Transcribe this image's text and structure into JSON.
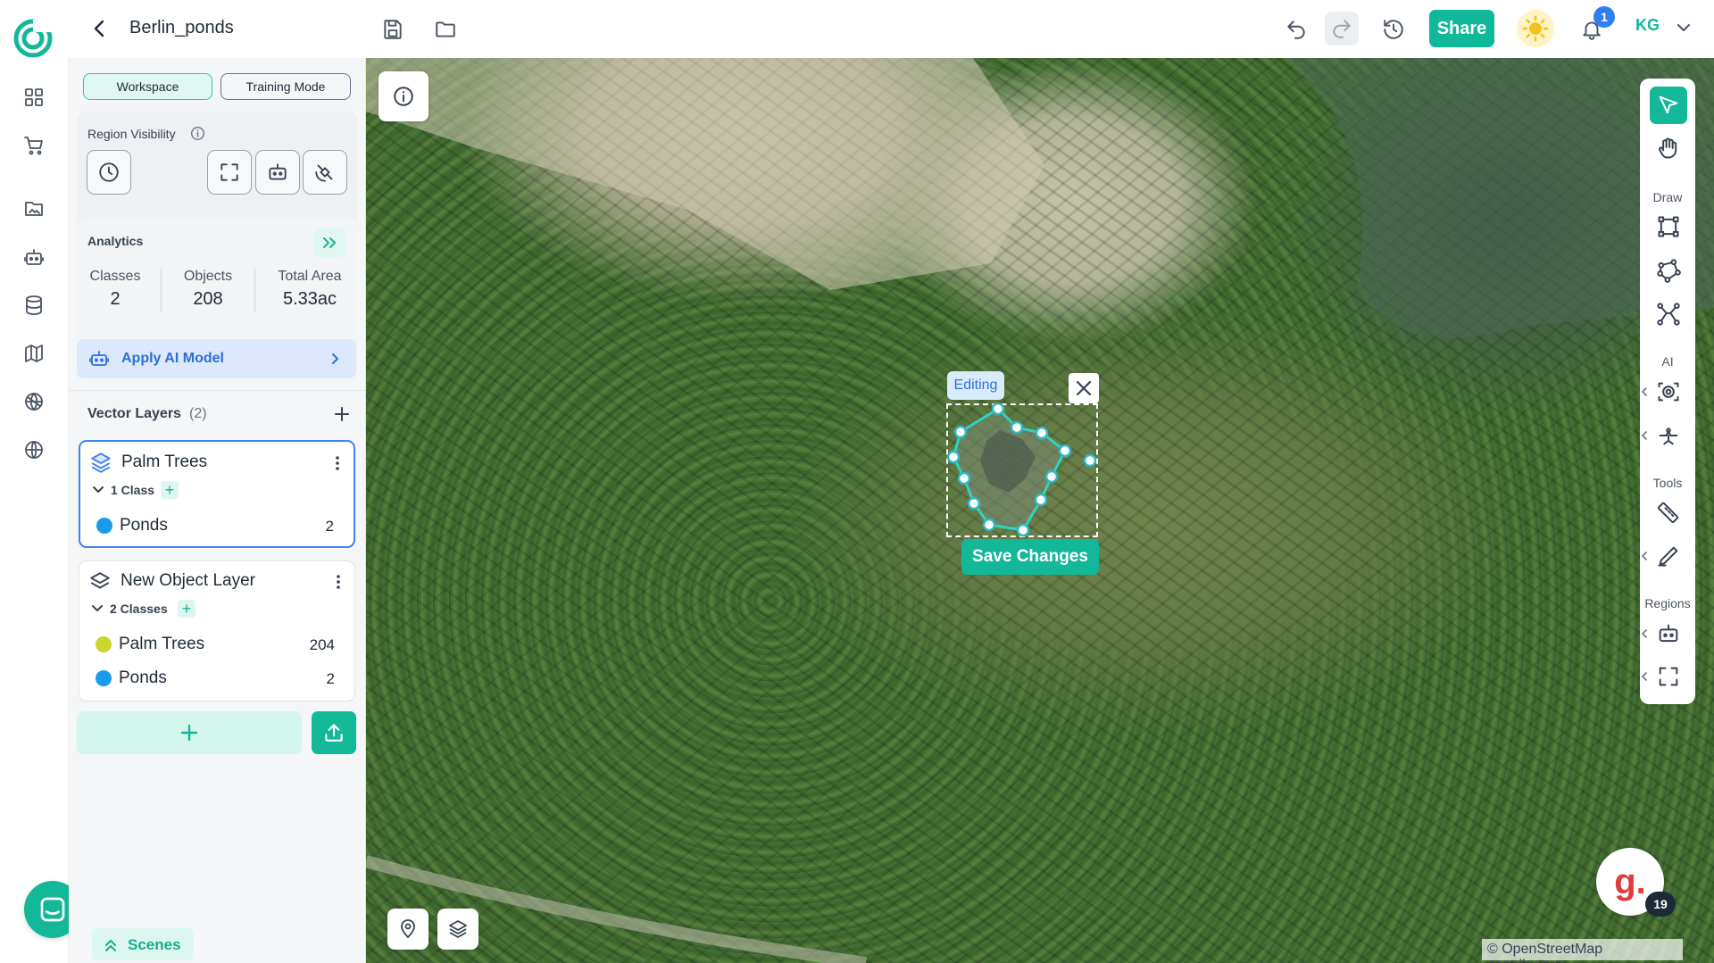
{
  "header": {
    "project_title": "Berlin_ponds",
    "share_label": "Share",
    "notification_count": "1",
    "user_initials": "KG"
  },
  "panel": {
    "mode_tabs": [
      "Workspace",
      "Training Mode"
    ],
    "region_visibility_label": "Region Visibility",
    "analytics": {
      "title": "Analytics",
      "stats": [
        {
          "label": "Classes",
          "value": "2"
        },
        {
          "label": "Objects",
          "value": "208"
        },
        {
          "label": "Total Area",
          "value": "5.33ac"
        }
      ]
    },
    "apply_ai_label": "Apply AI Model",
    "vector_layers": {
      "title": "Vector Layers",
      "count": "(2)",
      "layers": [
        {
          "name": "Palm Trees",
          "class_count": "1 Class",
          "classes": [
            {
              "name": "Ponds",
              "count": "2",
              "color": "#1a9be8"
            }
          ]
        },
        {
          "name": "New Object Layer",
          "class_count": "2 Classes",
          "classes": [
            {
              "name": "Palm Trees",
              "count": "204",
              "color": "#c9d62f"
            },
            {
              "name": "Ponds",
              "count": "2",
              "color": "#1a9be8"
            }
          ]
        }
      ]
    },
    "scenes_label": "Scenes"
  },
  "map": {
    "editing_label": "Editing",
    "save_changes_label": "Save Changes",
    "attribution": "© OpenStreetMap contributors."
  },
  "right_toolbar": {
    "sections": [
      "Draw",
      "AI",
      "Tools",
      "Regions"
    ]
  },
  "assistant_badge": {
    "letter": "g.",
    "count": "19"
  },
  "colors": {
    "accent": "#13b898",
    "blue": "#2f6fd6",
    "pond": "#1a9be8",
    "palm": "#c9d62f"
  }
}
